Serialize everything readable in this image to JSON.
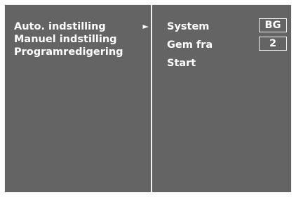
{
  "menu": {
    "items": [
      {
        "label": "Auto. indstilling",
        "selected": true,
        "arrow": "►"
      },
      {
        "label": "Manuel indstilling",
        "selected": false
      },
      {
        "label": "Programredigering",
        "selected": false
      }
    ]
  },
  "settings": {
    "system": {
      "label": "System",
      "value": "BG"
    },
    "gem_fra": {
      "label": "Gem fra",
      "value": "2"
    },
    "start": {
      "label": "Start"
    }
  },
  "colors": {
    "background": "#646464",
    "text": "#ffffff",
    "border": "#f2f2f2"
  }
}
